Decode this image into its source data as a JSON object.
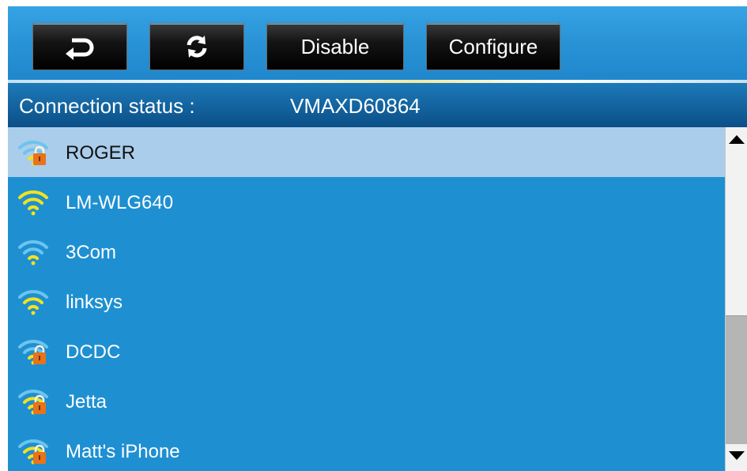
{
  "toolbar": {
    "back_icon": "return-arrow-icon",
    "refresh_icon": "refresh-icon",
    "disable_label": "Disable",
    "configure_label": "Configure"
  },
  "status": {
    "label": "Connection status :",
    "value": "VMAXD60864"
  },
  "networks": [
    {
      "name": "ROGER",
      "secured": true,
      "signal": "weak",
      "selected": true
    },
    {
      "name": "LM-WLG640",
      "secured": false,
      "signal": "strong",
      "selected": false
    },
    {
      "name": "3Com",
      "secured": false,
      "signal": "weak",
      "selected": false
    },
    {
      "name": "linksys",
      "secured": false,
      "signal": "medium",
      "selected": false
    },
    {
      "name": "DCDC",
      "secured": true,
      "signal": "weak",
      "selected": false
    },
    {
      "name": "Jetta",
      "secured": true,
      "signal": "medium",
      "selected": false
    },
    {
      "name": "Matt's iPhone",
      "secured": true,
      "signal": "medium",
      "selected": false
    }
  ],
  "scrollbar": {
    "up_icon": "scroll-up-arrow-icon",
    "down_icon": "scroll-down-arrow-icon"
  },
  "colors": {
    "toolbar": "#2a93d6",
    "status_bar": "#0b4f87",
    "list_bg": "#1e90d2",
    "selected_row": "#a9cdea",
    "signal_yellow": "#f4e21c",
    "signal_faint": "#6cc4ef",
    "lock_orange": "#e8731a"
  }
}
